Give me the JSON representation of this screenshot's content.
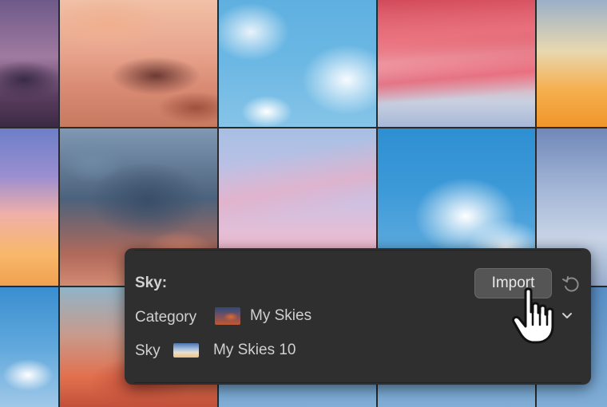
{
  "panel": {
    "title": "Sky:",
    "import_label": "Import",
    "category_label": "Category",
    "category_value": "My Skies",
    "sky_label": "Sky",
    "sky_value": "My Skies 10"
  },
  "icons": {
    "undo": "undo-icon",
    "chevron": "chevron-down-icon",
    "cursor": "hand-pointer-cursor"
  },
  "colors": {
    "panel_bg": "#2f2f2f",
    "button_bg": "#555555",
    "text": "#d0d0d0"
  }
}
